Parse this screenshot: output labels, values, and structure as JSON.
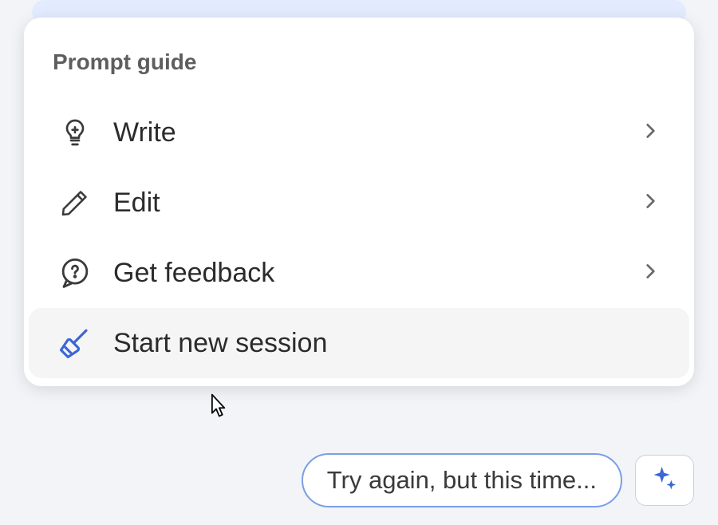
{
  "menu": {
    "title": "Prompt guide",
    "items": [
      {
        "label": "Write",
        "icon": "lightbulb",
        "hasChevron": true,
        "hovered": false
      },
      {
        "label": "Edit",
        "icon": "pencil",
        "hasChevron": true,
        "hovered": false
      },
      {
        "label": "Get feedback",
        "icon": "chat-question",
        "hasChevron": true,
        "hovered": false
      },
      {
        "label": "Start new session",
        "icon": "broom",
        "hasChevron": false,
        "hovered": true
      }
    ]
  },
  "bottomBar": {
    "pillLabel": "Try again, but this time..."
  },
  "colors": {
    "accent": "#3b66d6",
    "iconStroke": "#3a3a3a",
    "broomStroke": "#3b66d6"
  }
}
